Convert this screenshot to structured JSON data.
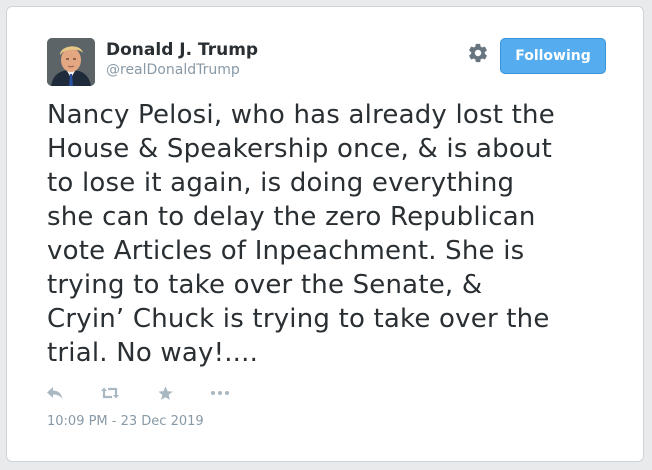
{
  "user": {
    "display_name": "Donald J. Trump",
    "screen_name": "@realDonaldTrump",
    "avatar_icon": "profile-photo"
  },
  "follow_button": {
    "label": "Following",
    "color": "#55acee"
  },
  "settings_icon": "gear-icon",
  "tweet": {
    "lines": [
      "Nancy Pelosi, who has already lost the",
      "House & Speakership once, & is about",
      "to lose it again, is doing everything",
      "she can to delay the zero Republican",
      "vote Articles of Inpeachment. She is",
      "trying to take over the Senate, &",
      "Cryin’ Chuck is trying to take over the",
      "trial. No way!...."
    ],
    "timestamp": "10:09 PM - 23 Dec 2019"
  },
  "actions": [
    {
      "icon": "reply-icon"
    },
    {
      "icon": "retweet-icon"
    },
    {
      "icon": "favorite-icon"
    },
    {
      "icon": "more-icon"
    }
  ],
  "colors": {
    "text": "#292f33",
    "muted": "#8899a6",
    "icon": "#aab8c2"
  }
}
